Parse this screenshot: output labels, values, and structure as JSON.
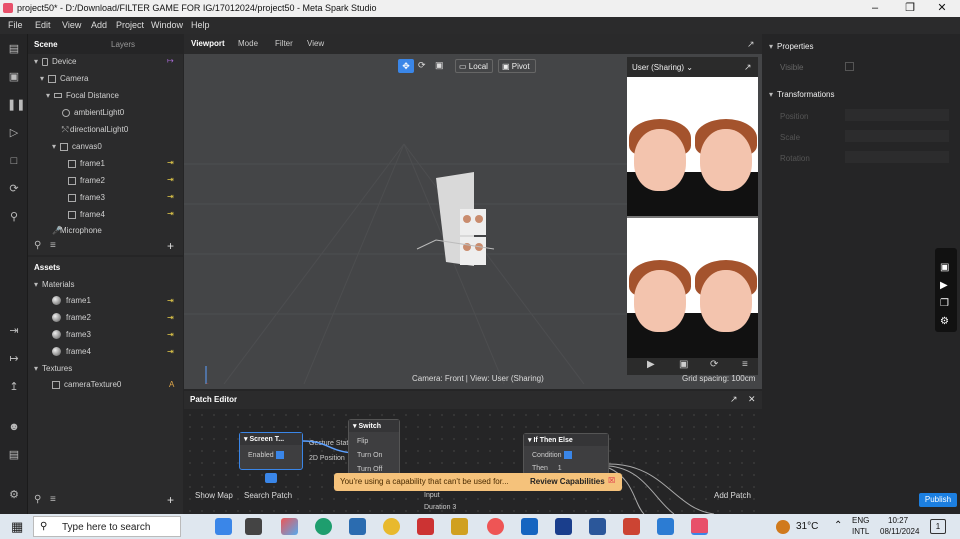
{
  "window": {
    "title": "project50* - D:/Download/FILTER GAME FOR IG/17012024/project50 - Meta Spark Studio"
  },
  "menu": [
    "File",
    "Edit",
    "View",
    "Add",
    "Project",
    "Window",
    "Help"
  ],
  "scene": {
    "tabs": [
      "Scene",
      "Layers"
    ],
    "items": [
      "Device",
      "Camera",
      "Focal Distance",
      "ambientLight0",
      "directionalLight0",
      "canvas0",
      "frame1",
      "frame2",
      "frame3",
      "frame4",
      "Microphone"
    ]
  },
  "assets": {
    "title": "Assets",
    "materials_label": "Materials",
    "materials": [
      "frame1",
      "frame2",
      "frame3",
      "frame4"
    ],
    "textures_label": "Textures",
    "textures": [
      "cameraTexture0"
    ],
    "texture_badge": "A"
  },
  "viewport": {
    "tabs": [
      "Viewport",
      "Mode",
      "Filter",
      "View"
    ],
    "local": "Local",
    "pivot": "Pivot",
    "status": "Camera: Front | View: User (Sharing)",
    "grid": "Grid spacing: 100cm"
  },
  "preview": {
    "label": "User (Sharing)"
  },
  "patch": {
    "title": "Patch Editor",
    "screen_tap": {
      "title": "Screen T...",
      "enabled": "Enabled"
    },
    "switch": {
      "title": "Switch",
      "ports": [
        "Flip",
        "Turn On",
        "Turn Off"
      ]
    },
    "ifthen": {
      "title": "If Then Else",
      "condition": "Condition",
      "then": "Then",
      "then_val": "1"
    },
    "gesture": "Gesture State",
    "position": "2D Position",
    "input": "Input",
    "input2": "Duration",
    "input2_val": "3",
    "show_map": "Show Map",
    "search": "Search Patch",
    "add": "Add Patch",
    "warning": "You're using a capability that can't be used for...",
    "review": "Review Capabilities"
  },
  "properties": {
    "title": "Properties",
    "visible": "Visible",
    "transformations": "Transformations",
    "rows": [
      "Position",
      "Scale",
      "Rotation"
    ],
    "publish": "Publish"
  },
  "taskbar": {
    "search": "Type here to search",
    "weather": "31°C",
    "lang1": "ENG",
    "lang2": "INTL",
    "time": "10:27",
    "date": "08/11/2024",
    "notif": "1"
  }
}
